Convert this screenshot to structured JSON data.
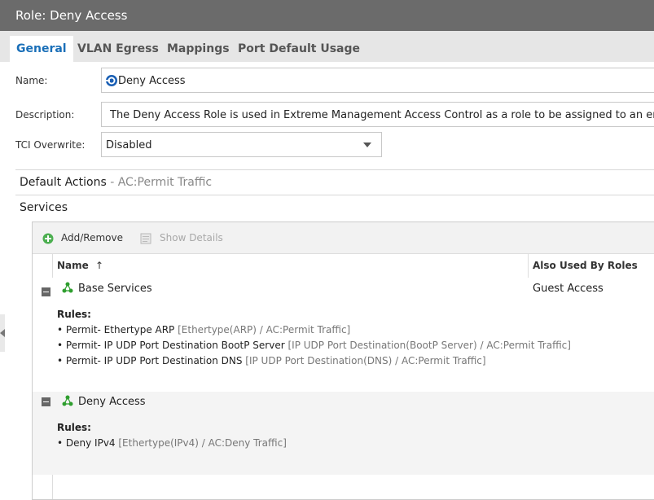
{
  "window": {
    "title": "Role: Deny Access"
  },
  "tabs": [
    {
      "label": "General",
      "active": true
    },
    {
      "label": "VLAN Egress",
      "active": false
    },
    {
      "label": "Mappings",
      "active": false
    },
    {
      "label": "Port Default Usage",
      "active": false
    }
  ],
  "form": {
    "name_label": "Name:",
    "name_value": "Deny Access",
    "description_label": "Description:",
    "description_value": "The Deny Access Role is used in Extreme Management Access Control as a role to be assigned to an end-system",
    "tci_label": "TCI Overwrite:",
    "tci_value": "Disabled"
  },
  "default_actions": {
    "label": "Default Actions",
    "separator": " - ",
    "value": "AC:Permit Traffic"
  },
  "services": {
    "label": "Services",
    "toolbar": {
      "add_remove": "Add/Remove",
      "show_details": "Show Details"
    },
    "columns": {
      "name": "Name",
      "sort_indicator": "↑",
      "also_used": "Also Used By Roles"
    },
    "rows": [
      {
        "name": "Base Services",
        "also_used": "Guest Access",
        "rules_title": "Rules:",
        "rules": [
          {
            "text": "• Permit- Ethertype ARP",
            "detail": " [Ethertype(ARP) / AC:Permit Traffic]"
          },
          {
            "text": "• Permit- IP UDP Port Destination BootP Server",
            "detail": " [IP UDP Port Destination(BootP Server) / AC:Permit Traffic]"
          },
          {
            "text": "• Permit- IP UDP Port Destination DNS",
            "detail": " [IP UDP Port Destination(DNS) / AC:Permit Traffic]"
          }
        ]
      },
      {
        "name": "Deny Access",
        "also_used": "",
        "rules_title": "Rules:",
        "rules": [
          {
            "text": "• Deny IPv4",
            "detail": " [Ethertype(IPv4) / AC:Deny Traffic]"
          }
        ]
      }
    ]
  },
  "colors": {
    "accent": "#1a6fb8",
    "titlebar": "#6b6b6b",
    "service_icon": "#2e9e2e"
  }
}
